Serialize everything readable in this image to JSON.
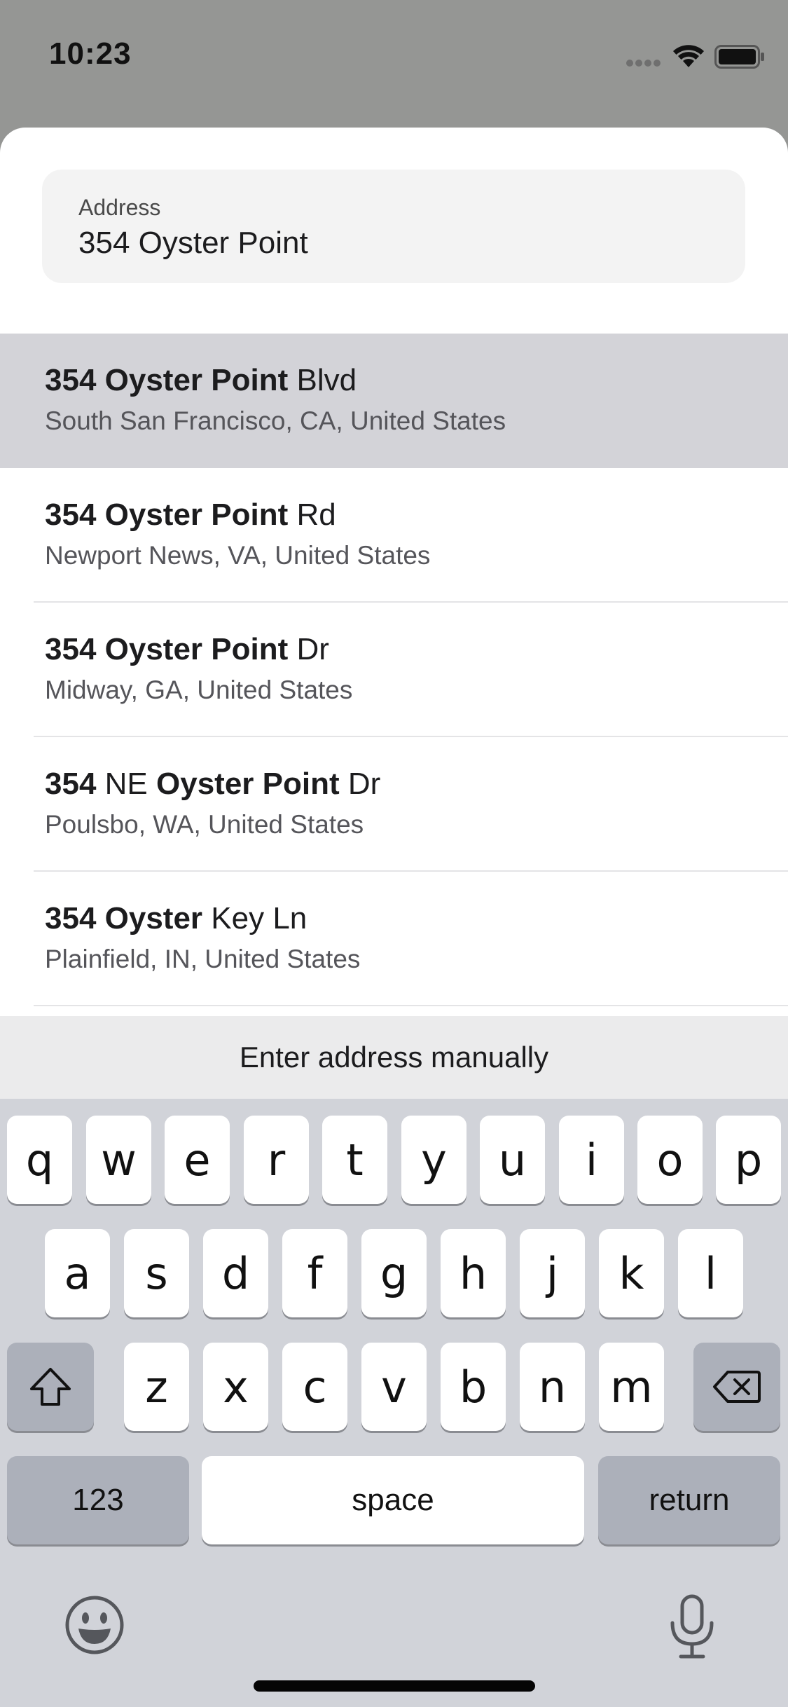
{
  "status_bar": {
    "time": "10:23",
    "icons": [
      "signal-dots-icon",
      "wifi-icon",
      "battery-icon"
    ]
  },
  "address": {
    "label": "Address",
    "value": "354 Oyster Point"
  },
  "results": [
    {
      "title_bold": "354 Oyster Point",
      "title_rest": " Blvd",
      "subtitle": "South San Francisco, CA, United States",
      "highlighted": true
    },
    {
      "title_bold": "354 Oyster Point",
      "title_rest": " Rd",
      "subtitle": "Newport News, VA, United States",
      "highlighted": false
    },
    {
      "title_bold": "354 Oyster Point",
      "title_rest": " Dr",
      "subtitle": "Midway, GA, United States",
      "highlighted": false
    },
    {
      "title_bold_1": "354",
      "title_mid": " NE ",
      "title_bold_2": "Oyster Point",
      "title_rest": " Dr",
      "subtitle": "Poulsbo, WA, United States",
      "highlighted": false
    },
    {
      "title_bold": "354 Oyster",
      "title_rest": " Key Ln",
      "subtitle": "Plainfield, IN, United States",
      "highlighted": false
    }
  ],
  "manual_entry": {
    "label": "Enter address manually"
  },
  "keyboard": {
    "row1": [
      "q",
      "w",
      "e",
      "r",
      "t",
      "y",
      "u",
      "i",
      "o",
      "p"
    ],
    "row2": [
      "a",
      "s",
      "d",
      "f",
      "g",
      "h",
      "j",
      "k",
      "l"
    ],
    "row3": [
      "z",
      "x",
      "c",
      "v",
      "b",
      "n",
      "m"
    ],
    "numbers_label": "123",
    "space_label": "space",
    "return_label": "return",
    "icons": [
      "shift-icon",
      "delete-icon",
      "emoji-icon",
      "microphone-icon"
    ]
  },
  "colors": {
    "highlight": "#d3d3d8",
    "keyboard_bg": "#d1d3d9",
    "dark_key": "#acb0ba",
    "dimmed_bg": "#959694"
  }
}
